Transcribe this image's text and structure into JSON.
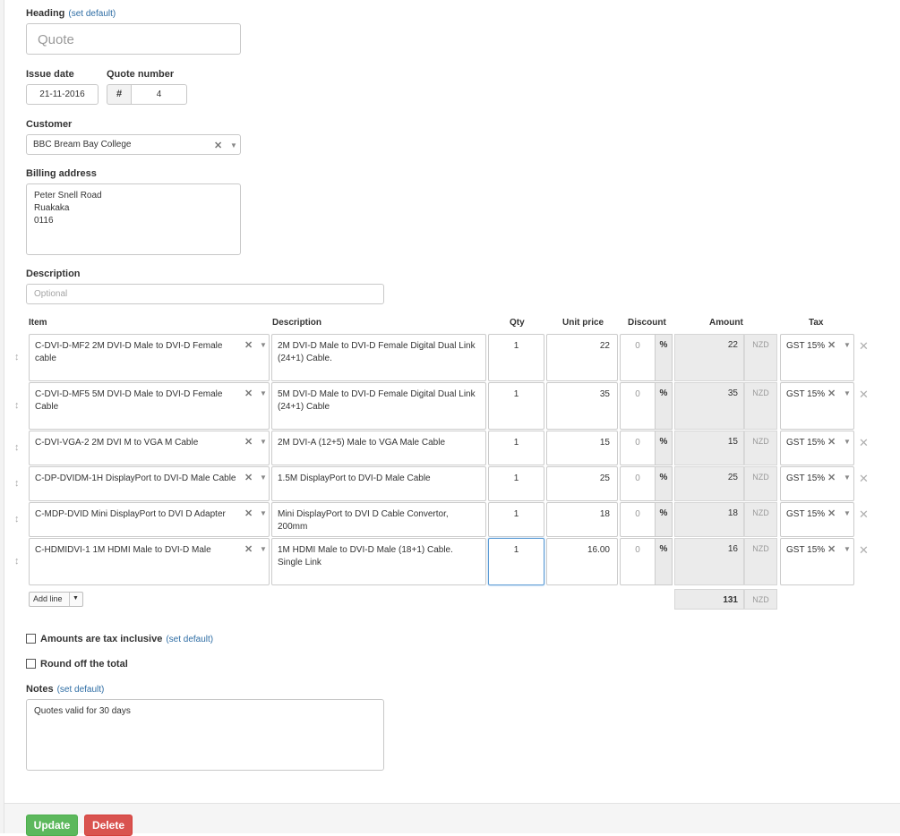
{
  "form": {
    "heading_label": "Heading",
    "heading_set_default": "(set default)",
    "heading_placeholder": "Quote",
    "issue_date_label": "Issue date",
    "issue_date_value": "21-11-2016",
    "quote_number_label": "Quote number",
    "quote_number_prefix": "#",
    "quote_number_value": "4",
    "customer_label": "Customer",
    "customer_value": "BBC Bream Bay College",
    "billing_address_label": "Billing address",
    "billing_address_lines": [
      "Peter Snell Road",
      "Ruakaka",
      "0116"
    ],
    "description_label": "Description",
    "description_placeholder": "Optional"
  },
  "table": {
    "headers": {
      "item": "Item",
      "description": "Description",
      "qty": "Qty",
      "unit_price": "Unit price",
      "discount": "Discount",
      "amount": "Amount",
      "tax": "Tax"
    },
    "percent_symbol": "%",
    "currency": "NZD",
    "rows": [
      {
        "item": "C-DVI-D-MF2 2M DVI-D Male to DVI-D Female cable",
        "description": "2M DVI-D Male to DVI-D Female Digital Dual Link (24+1) Cable.",
        "qty": "1",
        "unit_price": "22",
        "discount": "0",
        "amount": "22",
        "tax": "GST 15%"
      },
      {
        "item": "C-DVI-D-MF5 5M DVI-D Male to DVI-D Female Cable",
        "description": "5M DVI-D Male to DVI-D Female Digital Dual Link (24+1) Cable",
        "qty": "1",
        "unit_price": "35",
        "discount": "0",
        "amount": "35",
        "tax": "GST 15%"
      },
      {
        "item": "C-DVI-VGA-2 2M DVI M to VGA M Cable",
        "description": "2M DVI-A (12+5) Male to VGA Male Cable",
        "qty": "1",
        "unit_price": "15",
        "discount": "0",
        "amount": "15",
        "tax": "GST 15%"
      },
      {
        "item": "C-DP-DVIDM-1H DisplayPort to DVI-D Male Cable",
        "description": "1.5M DisplayPort to DVI-D Male Cable",
        "qty": "1",
        "unit_price": "25",
        "discount": "0",
        "amount": "25",
        "tax": "GST 15%"
      },
      {
        "item": "C-MDP-DVID Mini DisplayPort to DVI D Adapter",
        "description": "Mini DisplayPort to DVI D Cable Convertor, 200mm",
        "qty": "1",
        "unit_price": "18",
        "discount": "0",
        "amount": "18",
        "tax": "GST 15%"
      },
      {
        "item": "C-HDMIDVI-1 1M HDMI Male to DVI-D Male",
        "description": "1M HDMI Male to DVI-D Male (18+1) Cable. Single Link",
        "qty": "1",
        "unit_price": "16.00",
        "discount": "0",
        "amount": "16",
        "tax": "GST 15%"
      }
    ],
    "add_line_label": "Add line",
    "total": "131"
  },
  "options": {
    "tax_inclusive_label": "Amounts are tax inclusive",
    "tax_inclusive_set_default": "(set default)",
    "round_off_label": "Round off the total"
  },
  "notes": {
    "label": "Notes",
    "set_default": "(set default)",
    "value": "Quotes valid for 30 days"
  },
  "buttons": {
    "update": "Update",
    "delete": "Delete"
  },
  "icons": {
    "clear": "clear-x-icon",
    "dropdown": "dropdown-arrow-icon",
    "drag": "drag-handle-icon",
    "remove_row": "remove-row-icon"
  },
  "colors": {
    "update": "#5cb85c",
    "delete": "#d9534f",
    "link": "#2e6da4",
    "focus": "#5b9bd5"
  }
}
